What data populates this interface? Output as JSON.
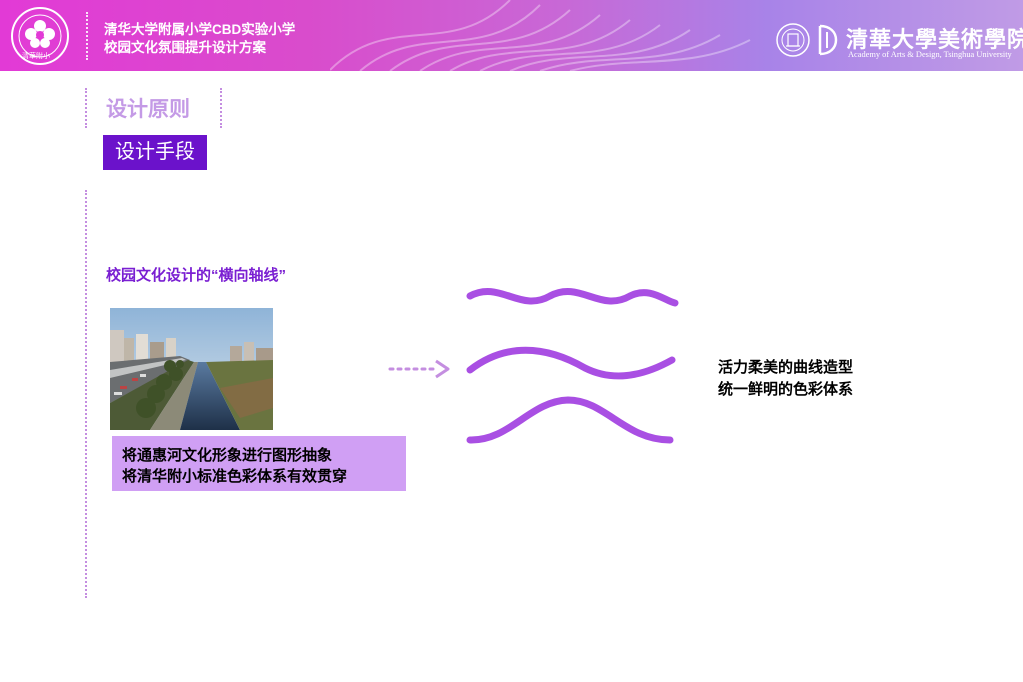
{
  "header": {
    "title_line1": "清华大学附属小学CBD实验小学",
    "title_line2": "校园文化氛围提升设计方案",
    "school_logo_text": "清華附小",
    "academy_name_cn": "清華大學美術學院",
    "academy_name_en": "Academy of Arts & Design, Tsinghua University"
  },
  "nav": {
    "section_title": "设计原则",
    "current_tab": "设计手段"
  },
  "main": {
    "axis_heading": "校园文化设计的“横向轴线”",
    "caption_line1": "将通惠河文化形象进行图形抽象",
    "caption_line2": "将清华附小标准色彩体系有效贯穿",
    "result_line1": "活力柔美的曲线造型",
    "result_line2": "统一鲜明的色彩体系"
  },
  "colors": {
    "accent_purple": "#6b12cb",
    "wave_purple": "#a94fe3",
    "light_purple": "#d09ff4",
    "header_magenta": "#e23ad6"
  },
  "icons": [
    "school-logo-icon",
    "academy-logo-icon",
    "dotted-arrow-icon"
  ]
}
